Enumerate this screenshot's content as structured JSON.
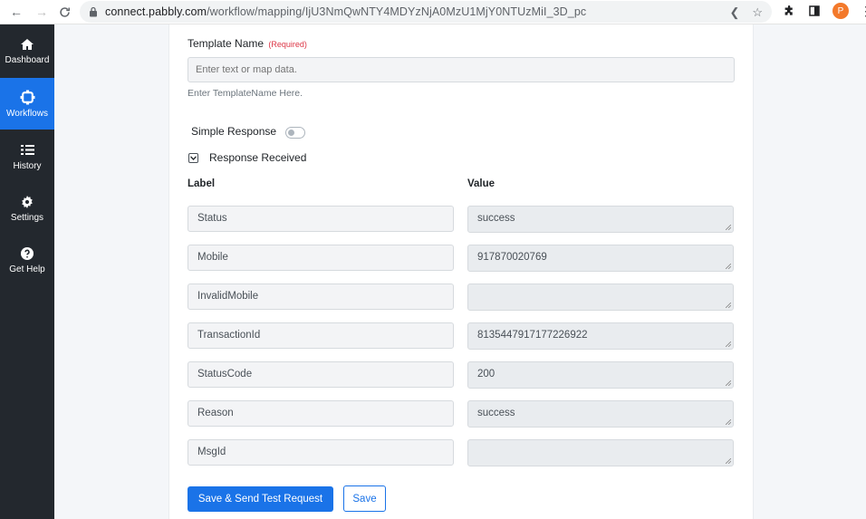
{
  "browser": {
    "url_host": "connect.pabbly.com",
    "url_path": "/workflow/mapping/IjU3NmQwNTY4MDYzNjA0MzU1MjY0NTUzMiI_3D_pc",
    "profile_initial": "P"
  },
  "sidebar": {
    "items": [
      {
        "label": "Dashboard",
        "icon": "home-icon",
        "active": false
      },
      {
        "label": "Workflows",
        "icon": "workflow-icon",
        "active": true
      },
      {
        "label": "History",
        "icon": "list-icon",
        "active": false
      },
      {
        "label": "Settings",
        "icon": "gear-icon",
        "active": false
      },
      {
        "label": "Get Help",
        "icon": "help-icon",
        "active": false
      }
    ]
  },
  "form": {
    "template_name_label": "Template Name",
    "required_text": "(Required)",
    "template_placeholder": "Enter text or map data.",
    "template_help": "Enter TemplateName Here.",
    "simple_response_label": "Simple Response",
    "simple_response_on": false,
    "response_received_label": "Response Received",
    "label_header": "Label",
    "value_header": "Value",
    "rows": [
      {
        "label": "Status",
        "value": "success"
      },
      {
        "label": "Mobile",
        "value": "917870020769"
      },
      {
        "label": "InvalidMobile",
        "value": ""
      },
      {
        "label": "TransactionId",
        "value": "8135447917177226922"
      },
      {
        "label": "StatusCode",
        "value": "200"
      },
      {
        "label": "Reason",
        "value": "success"
      },
      {
        "label": "MsgId",
        "value": ""
      }
    ],
    "save_send_label": "Save & Send Test Request",
    "save_label": "Save"
  },
  "colors": {
    "sidebar_bg": "#23282e",
    "accent": "#1a73e8",
    "required": "#dc3545"
  }
}
